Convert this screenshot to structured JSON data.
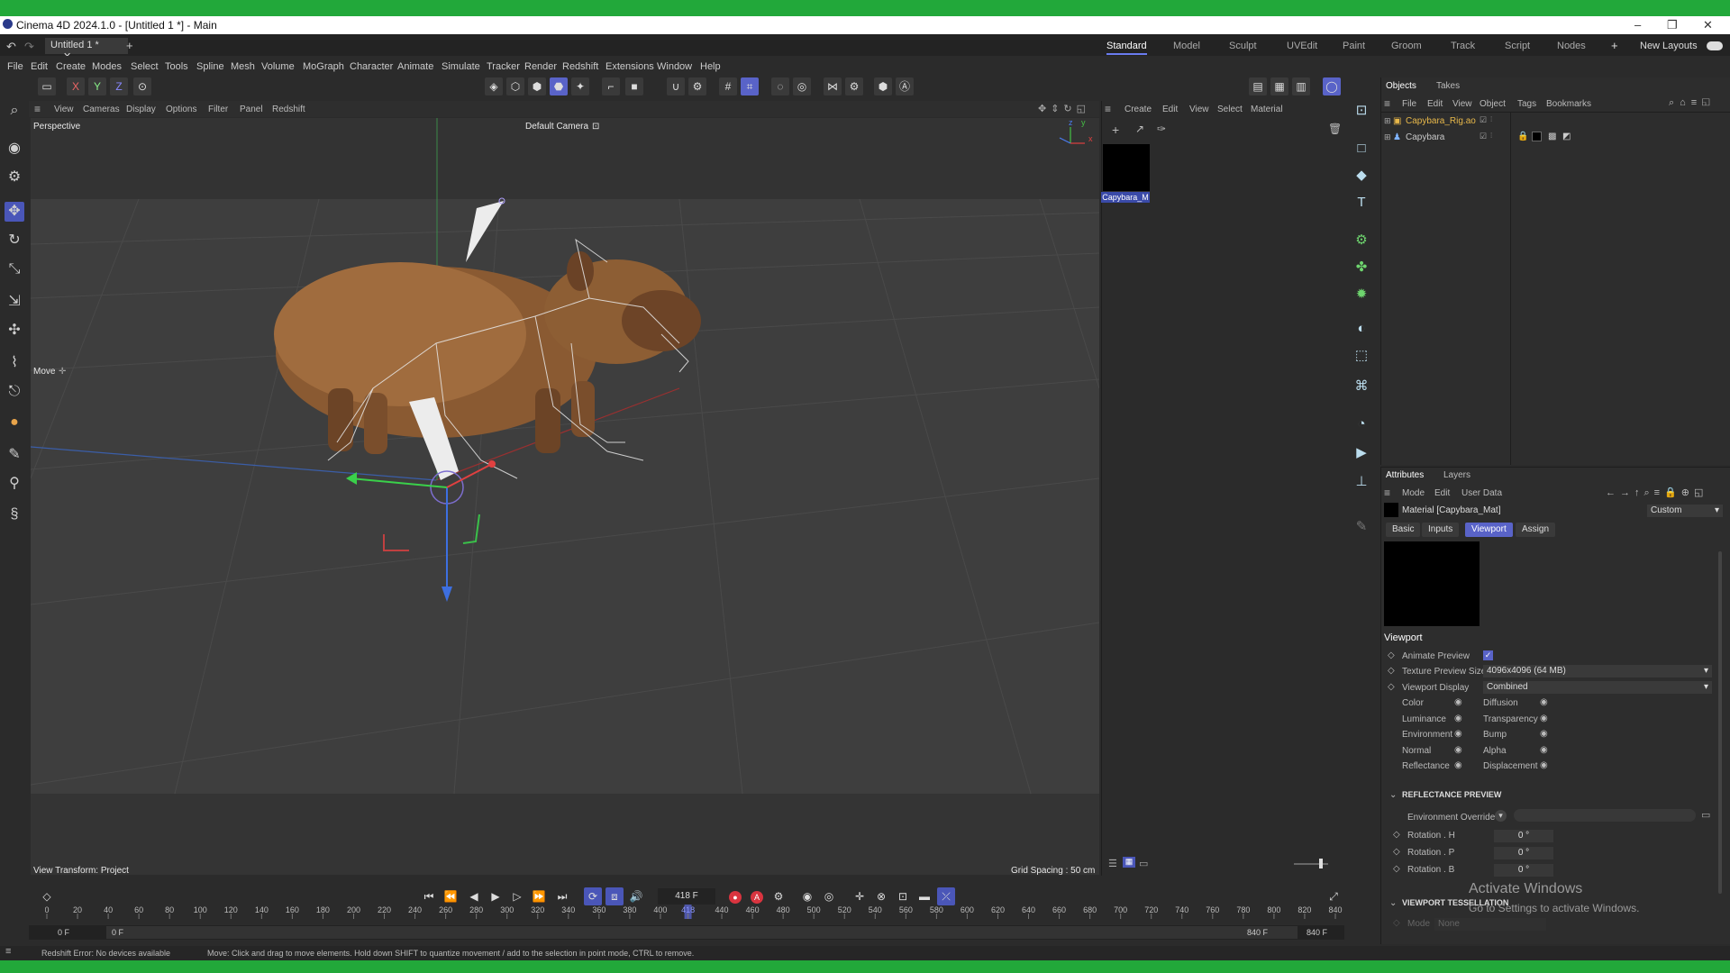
{
  "window": {
    "title": "Cinema 4D 2024.1.0 - [Untitled 1 *] - Main",
    "minimize": "–",
    "maximize": "❐",
    "close": "✕"
  },
  "doc_tab": {
    "label": "Untitled 1 *",
    "close": "✕",
    "add": "+"
  },
  "layouts": [
    "Standard",
    "Model",
    "Sculpt",
    "UVEdit",
    "Paint",
    "Groom",
    "Track",
    "Script",
    "Nodes"
  ],
  "layouts_add": "+",
  "new_layouts": "New Layouts",
  "menu": [
    "File",
    "Edit",
    "Create",
    "Modes",
    "Select",
    "Tools",
    "Spline",
    "Mesh",
    "Volume",
    "MoGraph",
    "Character",
    "Animate",
    "Simulate",
    "Tracker",
    "Render",
    "Redshift",
    "Extensions",
    "Window",
    "Help"
  ],
  "axis_buttons": [
    "X",
    "Y",
    "Z"
  ],
  "viewport": {
    "menu": [
      "View",
      "Cameras",
      "Display",
      "Options",
      "Filter",
      "Panel",
      "Redshift"
    ],
    "name": "Perspective",
    "camera": "Default Camera",
    "camera_icon": "⊡",
    "tool_label": "Move",
    "tool_icon": "✛",
    "view_transform": "View Transform: Project",
    "grid_spacing": "Grid Spacing : 50 cm",
    "axis": {
      "x": "x",
      "y": "y",
      "z": "z"
    }
  },
  "material_manager": {
    "menu": [
      "Create",
      "Edit",
      "View",
      "Select",
      "Material"
    ],
    "material_name": "Capybara_M"
  },
  "objects_panel": {
    "tabs": [
      "Objects",
      "Takes"
    ],
    "menu": [
      "File",
      "Edit",
      "View",
      "Object",
      "Tags",
      "Bookmarks"
    ],
    "items": [
      {
        "name": "Capybara_Rig.ao",
        "color": "#e8b84a"
      },
      {
        "name": "Capybara",
        "color": "#c8c8c8"
      }
    ]
  },
  "attributes": {
    "tabs": [
      "Attributes",
      "Layers"
    ],
    "menu": [
      "Mode",
      "Edit",
      "User Data"
    ],
    "material_title": "Material [Capybara_Mat]",
    "preset": "Custom",
    "subtabs": [
      "Basic",
      "Inputs",
      "Viewport",
      "Assign"
    ],
    "active_subtab": "Viewport",
    "section": "Viewport",
    "animate_preview_label": "Animate Preview",
    "animate_preview_check": "✓",
    "texture_preview_label": "Texture Preview Size",
    "texture_preview_value": "4096x4096 (64 MB)",
    "viewport_display_label": "Viewport Display",
    "viewport_display_value": "Combined",
    "channels_left": [
      "Color",
      "Luminance",
      "Environment",
      "Normal",
      "Reflectance"
    ],
    "channels_right": [
      "Diffusion",
      "Transparency",
      "Bump",
      "Alpha",
      "Displacement"
    ],
    "eye_icon": "◉",
    "reflectance_preview": "REFLECTANCE PREVIEW",
    "env_override_label": "Environment Override",
    "rotation_h_label": "Rotation . H",
    "rotation_p_label": "Rotation . P",
    "rotation_b_label": "Rotation . B",
    "rotation_h": "0 °",
    "rotation_p": "0 °",
    "rotation_b": "0 °",
    "viewport_tessellation": "VIEWPORT TESSELLATION",
    "mode_label": "Mode",
    "mode_value": "None"
  },
  "timeline": {
    "current_frame": "418 F",
    "ruler_ticks": [
      "0",
      "20",
      "40",
      "60",
      "80",
      "100",
      "120",
      "140",
      "160",
      "180",
      "200",
      "220",
      "240",
      "260",
      "280",
      "300",
      "320",
      "340",
      "360",
      "380",
      "400",
      "418",
      "440",
      "460",
      "480",
      "500",
      "520",
      "540",
      "560",
      "580",
      "600",
      "620",
      "640",
      "660",
      "680",
      "700",
      "720",
      "740",
      "760",
      "780",
      "800",
      "820",
      "840"
    ],
    "start_frame": "0 F",
    "min_frame": "0 F",
    "max_frame": "840 F",
    "end_frame": "840 F",
    "playhead_fraction": 0.4976
  },
  "status": {
    "redshift": "Redshift Error: No devices available",
    "hint": "Move: Click and drag to move elements. Hold down SHIFT to quantize movement / add to the selection in point mode, CTRL to remove."
  },
  "watermark": {
    "title": "Activate Windows",
    "subtitle": "Go to Settings to activate Windows."
  },
  "icons": {
    "undo": "undo-icon",
    "redo": "redo-icon",
    "search": "search-icon",
    "move": "move-icon",
    "rotate": "rotate-icon",
    "scale": "scale-icon",
    "play": "play-icon",
    "record": "record-icon"
  }
}
